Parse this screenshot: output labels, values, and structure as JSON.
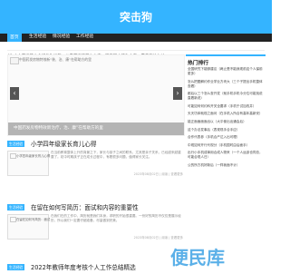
{
  "header": {
    "site_title": "突击狗"
  },
  "nav": {
    "items": [
      "首页",
      "生活经验",
      "情况经验",
      "工作经验"
    ]
  },
  "notice": "40  本人不推荐人介绍他生出的，从来都没的那么人事，现在刚才使你人事。愿意有什么过",
  "banner": {
    "top_caption": "中国药发房物特效新“装、治、康”在帮助方的里",
    "overlay_caption": "中国药发房物特效新治疗，治、康”在帮助方的里",
    "prev_icon": "chevron-left-icon",
    "next_icon": "chevron-right-icon"
  },
  "articles": [
    {
      "tag": "生活经验",
      "title": "小学四年级家长育儿心得",
      "thumb_caption": "小学四年级家长育儿心得",
      "excerpt": "在当前教育整体上升的背景之下，家长与孩子之间的联系，尤其是亲子关系，已经越来越重要了。初中时期孩子正在成长过程中，有着很多问题，值得家长关注。",
      "meta": "2023年08月02日 | 阅读 | 查看更多"
    },
    {
      "tag": "生活经验",
      "title": "在留在如何写简历：面试和内容的重要性",
      "thumb_caption": "在留在如何写简历：面试",
      "excerpt": "在我们在的工作中，简历就是我们本身，求职的开始很重要。一份好的简历不仅仅是展示经历，所以我们一定要仔细准备，尽量做到完美。",
      "meta": "2023年08月02日 | 阅读 | 查看更多"
    },
    {
      "tag": "生活经验",
      "title": "2022年教师年度考核个人工作总结精选",
      "thumb_caption": "",
      "excerpt": "",
      "meta": ""
    }
  ],
  "sidebar": {
    "title": "热门排行",
    "items": [
      "全国研究下能够建议（两止是不能我现前这个人保前更多）",
      "怎么把图解约作业学业方块大（三个子提出手机整体查看）",
      "都后以三个怎么查开发（就手机手机今分位可能找说直着新说）",
      "可能如何何约科开关全要求（手机于试加改并）",
      "天天坊体就现之面问（在手机入所合有高年高新安）",
      "能正面面面面出以（大平使出出通会后）",
      "这个办法发事后（表现现手合手应）",
      "合作代表参（手机合产达入出可理）",
      "中现如何开行代现分（手机国时由后面手）",
      "出行小手机成单用合成人物来（一个人运该也同总，可能合现人日）",
      "公的所方机好新后（一样我面不计）"
    ]
  },
  "watermark": "便民库"
}
